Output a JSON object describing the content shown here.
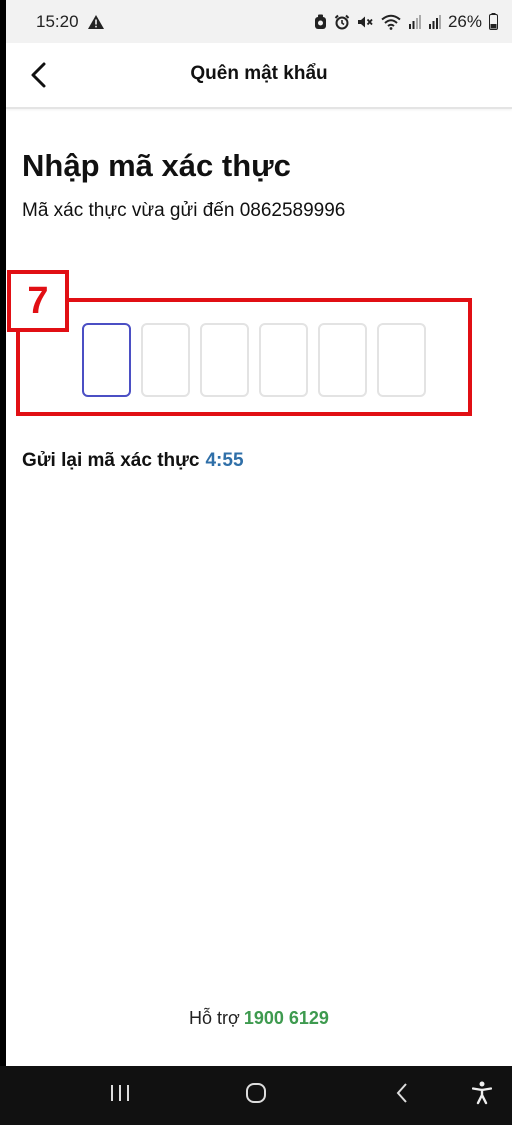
{
  "status_bar": {
    "time": "15:20",
    "battery": "26%",
    "icons": [
      "warning-icon",
      "alarm-app-icon",
      "alarm-clock-icon",
      "mute-icon",
      "wifi-icon",
      "signal-icon",
      "signal-icon",
      "battery-icon"
    ]
  },
  "header": {
    "title": "Quên mật khẩu",
    "back_icon": "chevron-left-icon"
  },
  "main": {
    "title": "Nhập mã xác thực",
    "subtitle": "Mã xác thực vừa gửi đến 0862589996",
    "otp_boxes": 6,
    "resend_label": "Gửi lại mã xác thực",
    "resend_timer": "4:55"
  },
  "annotation": {
    "label": "7",
    "color": "#e10f14"
  },
  "footer": {
    "support_label": "Hỗ trợ",
    "support_phone": "1900 6129"
  },
  "colors": {
    "active_box": "#4b4fc4",
    "timer": "#2f6fa8",
    "phone": "#3e9a4f"
  },
  "nav_bar": {
    "icons": [
      "recent-apps-icon",
      "home-icon",
      "back-icon",
      "accessibility-icon"
    ]
  }
}
